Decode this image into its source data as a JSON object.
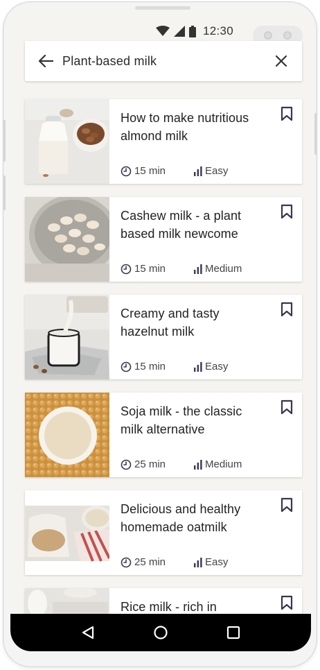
{
  "status_bar": {
    "time": "12:30",
    "icons": [
      "wifi-icon",
      "cellular-icon",
      "battery-icon"
    ]
  },
  "search": {
    "query": "Plant-based milk",
    "back_icon": "arrow-left-icon",
    "clear_icon": "close-icon"
  },
  "recipes": [
    {
      "title": "How to make nutritious almond milk",
      "time": "15 min",
      "level": "Easy",
      "image": "almond-milk-photo"
    },
    {
      "title": "Cashew milk - a plant based milk newcome",
      "time": "15 min",
      "level": "Medium",
      "image": "cashew-milk-photo"
    },
    {
      "title": "Creamy and tasty hazelnut milk",
      "time": "15 min",
      "level": "Easy",
      "image": "hazelnut-milk-photo"
    },
    {
      "title": "Soja milk - the classic milk alternative",
      "time": "25 min",
      "level": "Medium",
      "image": "soja-milk-photo"
    },
    {
      "title": "Delicious and healthy homemade oatmilk",
      "time": "25 min",
      "level": "Easy",
      "image": "oat-milk-photo"
    },
    {
      "title": "Rice milk - rich in",
      "time": "",
      "level": "",
      "image": "rice-milk-photo"
    }
  ],
  "nav": {
    "back": "triangle-back-icon",
    "home": "circle-home-icon",
    "recents": "square-recents-icon"
  },
  "colors": {
    "background": "#f6f4f1",
    "card": "#ffffff",
    "text": "#222222",
    "icon": "#3a3550",
    "nav_bar": "#000000"
  }
}
